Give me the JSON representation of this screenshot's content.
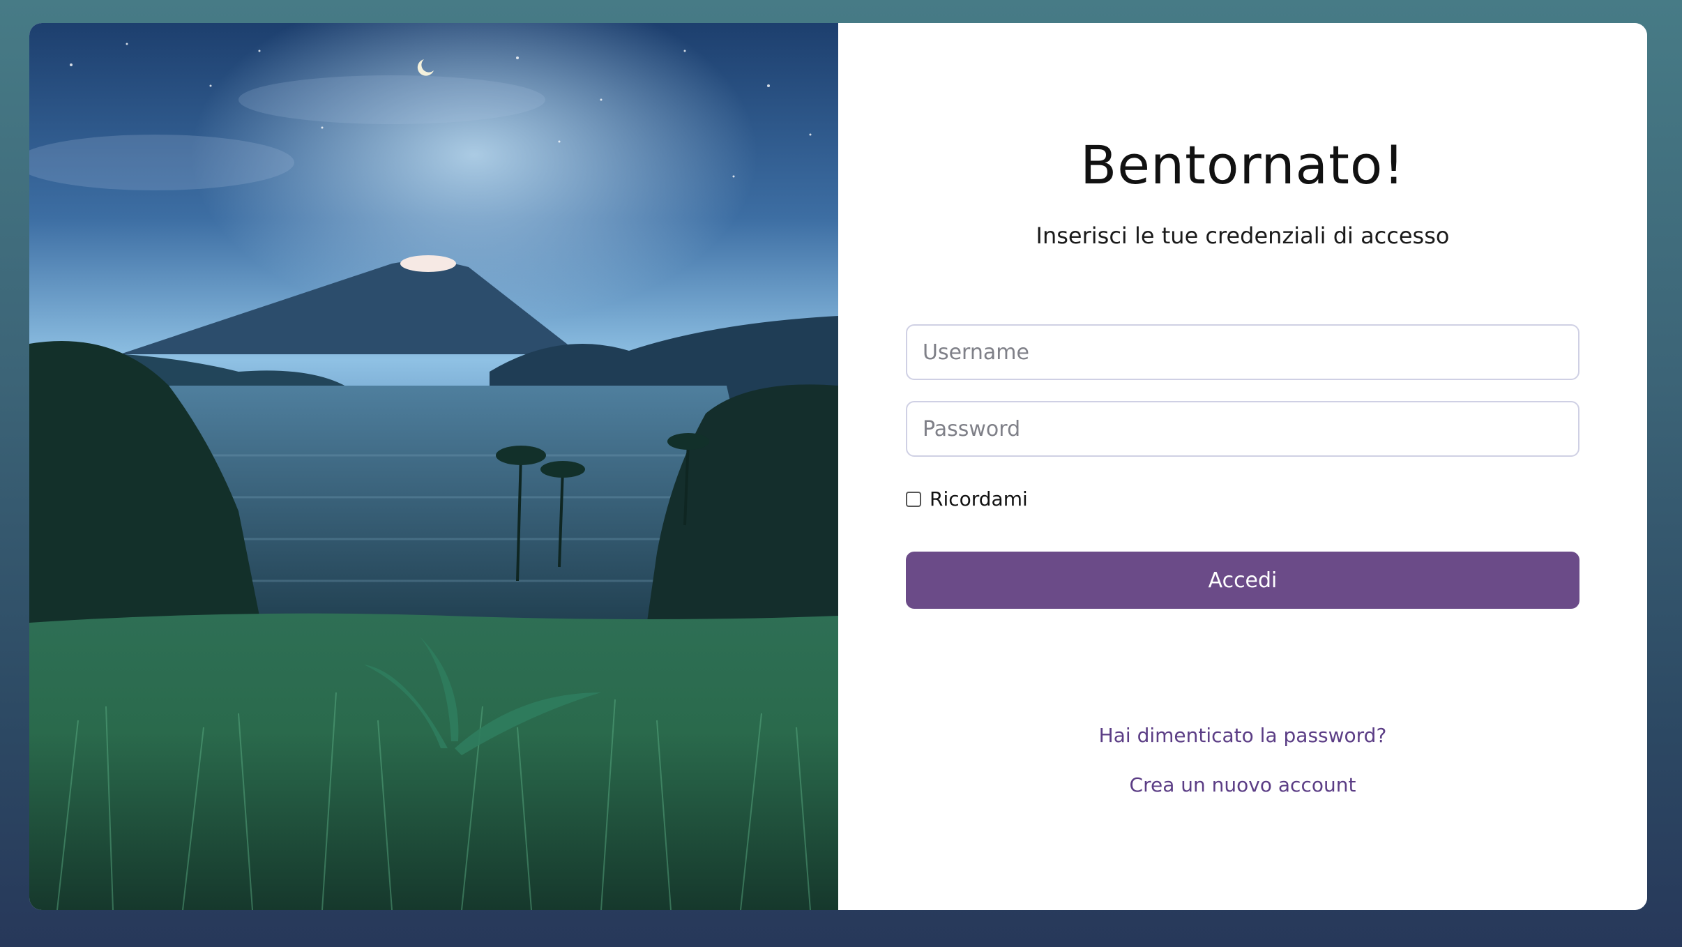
{
  "login": {
    "title": "Bentornato!",
    "subtitle": "Inserisci le tue credenziali di accesso",
    "username_placeholder": "Username",
    "username_value": "",
    "password_placeholder": "Password",
    "password_value": "",
    "remember_label": "Ricordami",
    "remember_checked": false,
    "submit_label": "Accedi",
    "forgot_link": "Hai dimenticato la password?",
    "create_link": "Crea un nuovo account"
  },
  "colors": {
    "accent": "#6b4b88",
    "link": "#5b3d85",
    "input_border": "#cfd0e4"
  },
  "image": {
    "icon": "volcano-landscape-photo"
  }
}
